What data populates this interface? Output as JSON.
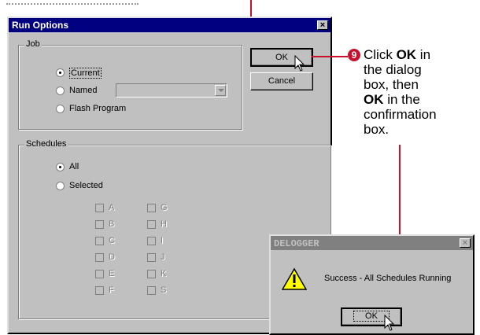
{
  "run_options": {
    "title": "Run Options",
    "close_glyph": "×",
    "job_group": {
      "label": "Job",
      "options": [
        "Current",
        "Named",
        "Flash Program"
      ],
      "selected": "Current",
      "named_select_value": ""
    },
    "schedules_group": {
      "label": "Schedules",
      "options": [
        "All",
        "Selected"
      ],
      "selected": "All",
      "checkboxes": [
        "A",
        "B",
        "C",
        "D",
        "E",
        "F",
        "G",
        "H",
        "I",
        "J",
        "K",
        "S"
      ]
    },
    "ok_label": "OK",
    "cancel_label": "Cancel"
  },
  "callout": {
    "step_number": "9",
    "line1_pre": "Click ",
    "line1_bold": "OK",
    "line1_post": " in",
    "line2": "the dialog",
    "line3": "box, then",
    "line4_bold": "OK",
    "line4_post": " in the",
    "line5": "confirmation",
    "line6": "box."
  },
  "confirmation": {
    "title": "DELOGGER",
    "close_glyph": "×",
    "message": "Success - All Schedules Running",
    "ok_label": "OK",
    "icon": "warning-icon"
  },
  "colors": {
    "titlebar_active": "#000080",
    "titlebar_inactive": "#808080",
    "callout_line": "#c8102e",
    "dialog_face": "#c0c0c0"
  }
}
